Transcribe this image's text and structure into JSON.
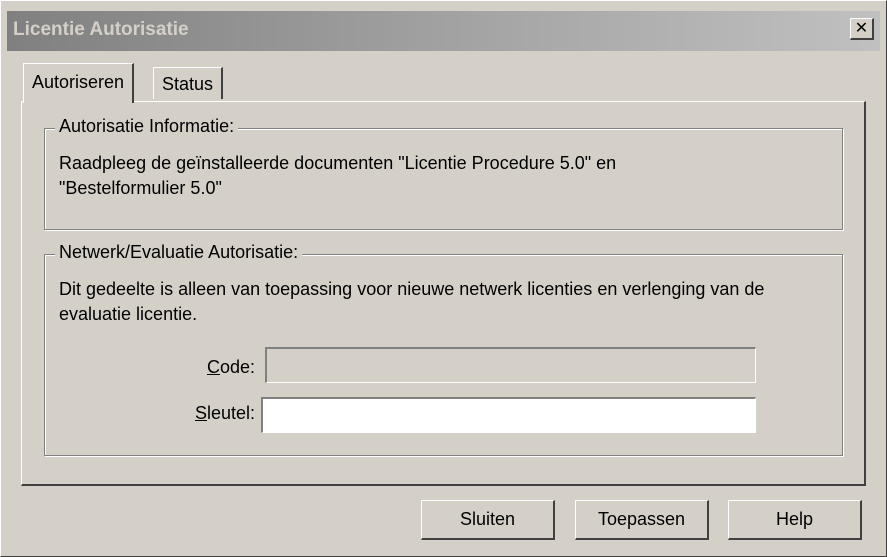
{
  "window": {
    "title": "Licentie Autorisatie",
    "close_glyph": "✕"
  },
  "tabs": [
    {
      "label": "Autoriseren",
      "active": true
    },
    {
      "label": "Status",
      "active": false
    }
  ],
  "authorization_info": {
    "legend": "Autorisatie Informatie:",
    "text": "Raadpleeg de geïnstalleerde documenten \"Licentie Procedure 5.0\" en \"Bestelformulier 5.0\""
  },
  "network_eval": {
    "legend": "Netwerk/Evaluatie Autorisatie:",
    "text": "Dit gedeelte is alleen van toepassing voor nieuwe netwerk licenties en verlenging van de evaluatie licentie.",
    "code_label_mnemonic": "C",
    "code_label_rest": "ode:",
    "code_value": "",
    "key_label_mnemonic": "S",
    "key_label_rest": "leutel:",
    "key_value": ""
  },
  "buttons": {
    "close": "Sluiten",
    "apply": "Toepassen",
    "help": "Help"
  },
  "colors": {
    "face": "#d4d0c8",
    "titlebar_start": "#808080",
    "titlebar_end": "#c0c0c0",
    "title_text": "#d4d0c8"
  }
}
